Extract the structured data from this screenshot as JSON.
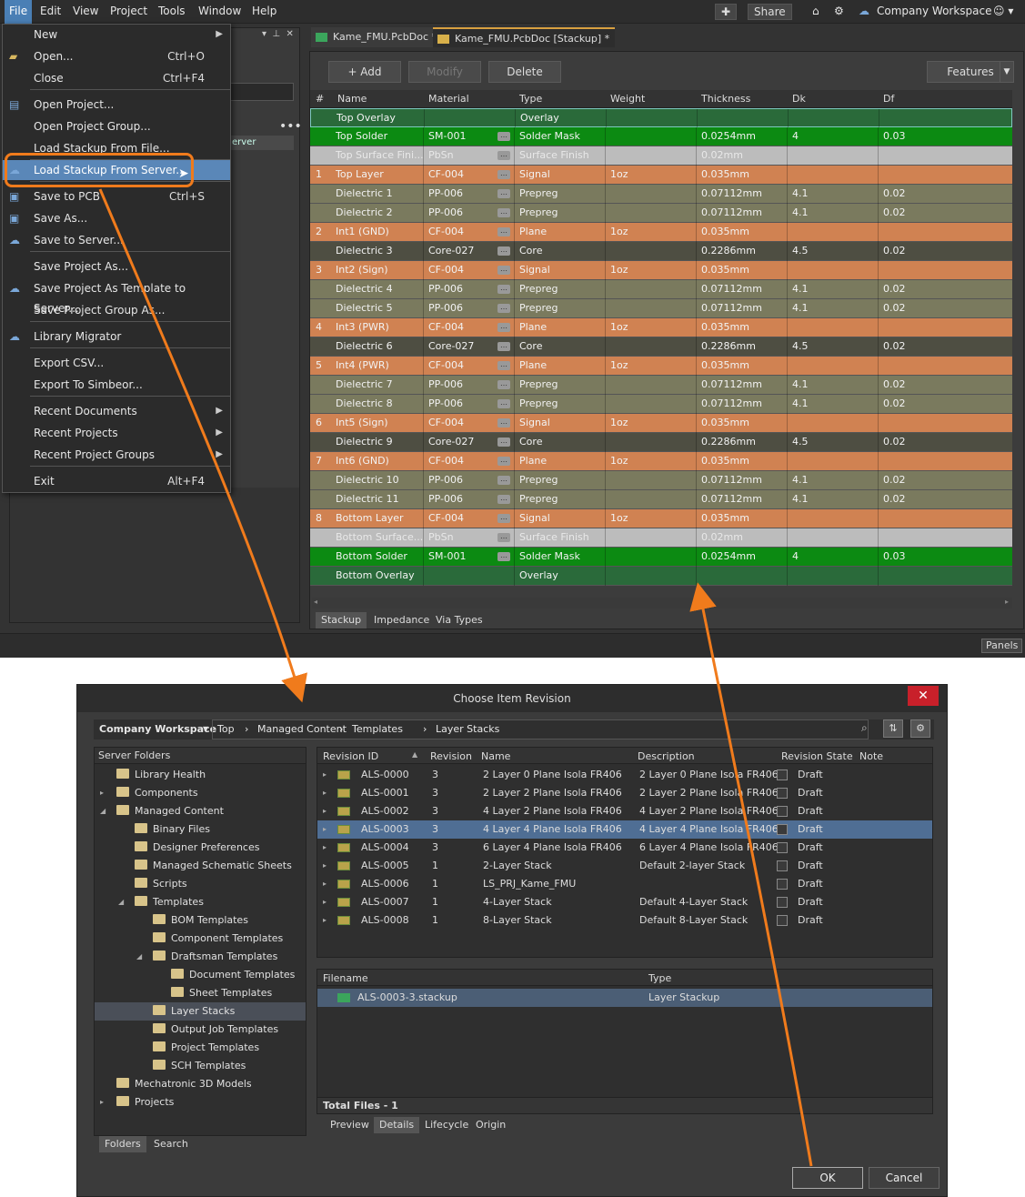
{
  "menubar": {
    "items": [
      "File",
      "Edit",
      "View",
      "Project",
      "Tools",
      "Window",
      "Help"
    ],
    "share": "Share",
    "workspace": "Company Workspace"
  },
  "file_menu": [
    {
      "label": "New",
      "shortcut": "",
      "submenu": true,
      "icon": ""
    },
    {
      "label": "Open...",
      "shortcut": "Ctrl+O",
      "submenu": false,
      "icon": "folder-open-icon"
    },
    {
      "label": "Close",
      "shortcut": "Ctrl+F4",
      "submenu": false,
      "icon": ""
    },
    {
      "label": "Open Project...",
      "shortcut": "",
      "submenu": false,
      "icon": "project-icon"
    },
    {
      "label": "Open Project Group...",
      "shortcut": "",
      "submenu": false,
      "icon": ""
    },
    {
      "label": "Load Stackup From File...",
      "shortcut": "",
      "submenu": false,
      "icon": ""
    },
    {
      "label": "Load Stackup From Server...",
      "shortcut": "",
      "submenu": false,
      "icon": "cloud-icon"
    },
    {
      "label": "Save to PCB",
      "shortcut": "Ctrl+S",
      "submenu": false,
      "icon": "save-icon"
    },
    {
      "label": "Save As...",
      "shortcut": "",
      "submenu": false,
      "icon": "save-as-icon"
    },
    {
      "label": "Save to Server...",
      "shortcut": "",
      "submenu": false,
      "icon": "cloud-save-icon"
    },
    {
      "label": "Save Project As...",
      "shortcut": "",
      "submenu": false,
      "icon": ""
    },
    {
      "label": "Save Project As Template to Server...",
      "shortcut": "",
      "submenu": false,
      "icon": "cloud-template-icon"
    },
    {
      "label": "Save Project Group As...",
      "shortcut": "",
      "submenu": false,
      "icon": ""
    },
    {
      "label": "Library Migrator",
      "shortcut": "",
      "submenu": false,
      "icon": "cloud-icon"
    },
    {
      "label": "Export CSV...",
      "shortcut": "",
      "submenu": false,
      "icon": ""
    },
    {
      "label": "Export To Simbeor...",
      "shortcut": "",
      "submenu": false,
      "icon": ""
    },
    {
      "label": "Recent Documents",
      "shortcut": "",
      "submenu": true,
      "icon": ""
    },
    {
      "label": "Recent Projects",
      "shortcut": "",
      "submenu": true,
      "icon": ""
    },
    {
      "label": "Recent Project Groups",
      "shortcut": "",
      "submenu": true,
      "icon": ""
    },
    {
      "label": "Exit",
      "shortcut": "Alt+F4",
      "submenu": false,
      "icon": ""
    }
  ],
  "left_panel": {
    "partial_text": "erver"
  },
  "doc_tabs": [
    "Kame_FMU.PcbDoc *",
    "Kame_FMU.PcbDoc [Stackup] *"
  ],
  "stackup": {
    "buttons": {
      "add": "+ Add",
      "modify": "Modify",
      "delete": "Delete",
      "features": "Features"
    },
    "columns": [
      "#",
      "Name",
      "Material",
      "Type",
      "Weight",
      "Thickness",
      "Dk",
      "Df"
    ],
    "rows": [
      {
        "num": "",
        "name": "Top Overlay",
        "material": "",
        "type": "Overlay",
        "weight": "",
        "thickness": "",
        "dk": "",
        "df": "",
        "color": "#2a6a3a"
      },
      {
        "num": "",
        "name": "Top Solder",
        "material": "SM-001",
        "type": "Solder Mask",
        "weight": "",
        "thickness": "0.0254mm",
        "dk": "4",
        "df": "0.03",
        "color": "#0c8a12"
      },
      {
        "num": "",
        "name": "Top Surface Fini...",
        "material": "PbSn",
        "type": "Surface Finish",
        "weight": "",
        "thickness": "0.02mm",
        "dk": "",
        "df": "",
        "color": "#bcbcbc"
      },
      {
        "num": "1",
        "name": "Top Layer",
        "material": "CF-004",
        "type": "Signal",
        "weight": "1oz",
        "thickness": "0.035mm",
        "dk": "",
        "df": "",
        "color": "#d08252"
      },
      {
        "num": "",
        "name": "Dielectric 1",
        "material": "PP-006",
        "type": "Prepreg",
        "weight": "",
        "thickness": "0.07112mm",
        "dk": "4.1",
        "df": "0.02",
        "color": "#7a7a5e"
      },
      {
        "num": "",
        "name": "Dielectric 2",
        "material": "PP-006",
        "type": "Prepreg",
        "weight": "",
        "thickness": "0.07112mm",
        "dk": "4.1",
        "df": "0.02",
        "color": "#7a7a5e"
      },
      {
        "num": "2",
        "name": "Int1 (GND)",
        "material": "CF-004",
        "type": "Plane",
        "weight": "1oz",
        "thickness": "0.035mm",
        "dk": "",
        "df": "",
        "color": "#d08252"
      },
      {
        "num": "",
        "name": "Dielectric 3",
        "material": "Core-027",
        "type": "Core",
        "weight": "",
        "thickness": "0.2286mm",
        "dk": "4.5",
        "df": "0.02",
        "color": "#4e4e42"
      },
      {
        "num": "3",
        "name": "Int2 (Sign)",
        "material": "CF-004",
        "type": "Signal",
        "weight": "1oz",
        "thickness": "0.035mm",
        "dk": "",
        "df": "",
        "color": "#d08252"
      },
      {
        "num": "",
        "name": "Dielectric 4",
        "material": "PP-006",
        "type": "Prepreg",
        "weight": "",
        "thickness": "0.07112mm",
        "dk": "4.1",
        "df": "0.02",
        "color": "#7a7a5e"
      },
      {
        "num": "",
        "name": "Dielectric 5",
        "material": "PP-006",
        "type": "Prepreg",
        "weight": "",
        "thickness": "0.07112mm",
        "dk": "4.1",
        "df": "0.02",
        "color": "#7a7a5e"
      },
      {
        "num": "4",
        "name": "Int3 (PWR)",
        "material": "CF-004",
        "type": "Plane",
        "weight": "1oz",
        "thickness": "0.035mm",
        "dk": "",
        "df": "",
        "color": "#d08252"
      },
      {
        "num": "",
        "name": "Dielectric 6",
        "material": "Core-027",
        "type": "Core",
        "weight": "",
        "thickness": "0.2286mm",
        "dk": "4.5",
        "df": "0.02",
        "color": "#4e4e42"
      },
      {
        "num": "5",
        "name": "Int4 (PWR)",
        "material": "CF-004",
        "type": "Plane",
        "weight": "1oz",
        "thickness": "0.035mm",
        "dk": "",
        "df": "",
        "color": "#d08252"
      },
      {
        "num": "",
        "name": "Dielectric 7",
        "material": "PP-006",
        "type": "Prepreg",
        "weight": "",
        "thickness": "0.07112mm",
        "dk": "4.1",
        "df": "0.02",
        "color": "#7a7a5e"
      },
      {
        "num": "",
        "name": "Dielectric 8",
        "material": "PP-006",
        "type": "Prepreg",
        "weight": "",
        "thickness": "0.07112mm",
        "dk": "4.1",
        "df": "0.02",
        "color": "#7a7a5e"
      },
      {
        "num": "6",
        "name": "Int5 (Sign)",
        "material": "CF-004",
        "type": "Signal",
        "weight": "1oz",
        "thickness": "0.035mm",
        "dk": "",
        "df": "",
        "color": "#d08252"
      },
      {
        "num": "",
        "name": "Dielectric 9",
        "material": "Core-027",
        "type": "Core",
        "weight": "",
        "thickness": "0.2286mm",
        "dk": "4.5",
        "df": "0.02",
        "color": "#4e4e42"
      },
      {
        "num": "7",
        "name": "Int6 (GND)",
        "material": "CF-004",
        "type": "Plane",
        "weight": "1oz",
        "thickness": "0.035mm",
        "dk": "",
        "df": "",
        "color": "#d08252"
      },
      {
        "num": "",
        "name": "Dielectric 10",
        "material": "PP-006",
        "type": "Prepreg",
        "weight": "",
        "thickness": "0.07112mm",
        "dk": "4.1",
        "df": "0.02",
        "color": "#7a7a5e"
      },
      {
        "num": "",
        "name": "Dielectric 11",
        "material": "PP-006",
        "type": "Prepreg",
        "weight": "",
        "thickness": "0.07112mm",
        "dk": "4.1",
        "df": "0.02",
        "color": "#7a7a5e"
      },
      {
        "num": "8",
        "name": "Bottom Layer",
        "material": "CF-004",
        "type": "Signal",
        "weight": "1oz",
        "thickness": "0.035mm",
        "dk": "",
        "df": "",
        "color": "#d08252"
      },
      {
        "num": "",
        "name": "Bottom Surface...",
        "material": "PbSn",
        "type": "Surface Finish",
        "weight": "",
        "thickness": "0.02mm",
        "dk": "",
        "df": "",
        "color": "#bcbcbc"
      },
      {
        "num": "",
        "name": "Bottom Solder",
        "material": "SM-001",
        "type": "Solder Mask",
        "weight": "",
        "thickness": "0.0254mm",
        "dk": "4",
        "df": "0.03",
        "color": "#0c8a12"
      },
      {
        "num": "",
        "name": "Bottom Overlay",
        "material": "",
        "type": "Overlay",
        "weight": "",
        "thickness": "",
        "dk": "",
        "df": "",
        "color": "#2a6a3a"
      }
    ],
    "tabs": [
      "Stackup",
      "Impedance",
      "Via Types"
    ]
  },
  "statusbar": {
    "panels": "Panels"
  },
  "dialog": {
    "title": "Choose Item Revision",
    "breadcrumb": [
      "Company Workspace",
      "Top",
      "Managed Content",
      "Templates",
      "Layer Stacks"
    ],
    "tree_header": "Server Folders",
    "tree": [
      {
        "label": "Library Health",
        "level": 0,
        "expander": ""
      },
      {
        "label": "Components",
        "level": 0,
        "expander": "▸"
      },
      {
        "label": "Managed Content",
        "level": 0,
        "expander": "◢"
      },
      {
        "label": "Binary Files",
        "level": 1,
        "expander": ""
      },
      {
        "label": "Designer Preferences",
        "level": 1,
        "expander": ""
      },
      {
        "label": "Managed Schematic Sheets",
        "level": 1,
        "expander": ""
      },
      {
        "label": "Scripts",
        "level": 1,
        "expander": ""
      },
      {
        "label": "Templates",
        "level": 1,
        "expander": "◢"
      },
      {
        "label": "BOM Templates",
        "level": 2,
        "expander": ""
      },
      {
        "label": "Component Templates",
        "level": 2,
        "expander": ""
      },
      {
        "label": "Draftsman Templates",
        "level": 2,
        "expander": "◢"
      },
      {
        "label": "Document Templates",
        "level": 3,
        "expander": ""
      },
      {
        "label": "Sheet Templates",
        "level": 3,
        "expander": ""
      },
      {
        "label": "Layer Stacks",
        "level": 2,
        "expander": "",
        "selected": true
      },
      {
        "label": "Output Job Templates",
        "level": 2,
        "expander": ""
      },
      {
        "label": "Project Templates",
        "level": 2,
        "expander": ""
      },
      {
        "label": "SCH Templates",
        "level": 2,
        "expander": ""
      },
      {
        "label": "Mechatronic 3D Models",
        "level": 0,
        "expander": ""
      },
      {
        "label": "Projects",
        "level": 0,
        "expander": "▸"
      }
    ],
    "tree_tabs": [
      "Folders",
      "Search"
    ],
    "rev_columns": [
      "Revision ID",
      "Revision",
      "Name",
      "Description",
      "Revision State",
      "Note"
    ],
    "revisions": [
      {
        "id": "ALS-0000",
        "rev": "3",
        "name": "2 Layer 0 Plane Isola FR406",
        "desc": "2 Layer 0 Plane Isola FR406",
        "state": "Draft"
      },
      {
        "id": "ALS-0001",
        "rev": "3",
        "name": "2 Layer 2 Plane Isola FR406",
        "desc": "2 Layer 2 Plane Isola FR406",
        "state": "Draft"
      },
      {
        "id": "ALS-0002",
        "rev": "3",
        "name": "4 Layer 2 Plane Isola FR406",
        "desc": "4 Layer 2 Plane Isola FR406",
        "state": "Draft"
      },
      {
        "id": "ALS-0003",
        "rev": "3",
        "name": "4 Layer 4 Plane Isola FR406",
        "desc": "4 Layer 4 Plane Isola FR406",
        "state": "Draft",
        "selected": true
      },
      {
        "id": "ALS-0004",
        "rev": "3",
        "name": "6 Layer 4 Plane Isola FR406",
        "desc": "6 Layer 4 Plane Isola FR406",
        "state": "Draft"
      },
      {
        "id": "ALS-0005",
        "rev": "1",
        "name": "2-Layer Stack",
        "desc": "Default 2-layer Stack",
        "state": "Draft"
      },
      {
        "id": "ALS-0006",
        "rev": "1",
        "name": "LS_PRJ_Kame_FMU",
        "desc": "",
        "state": "Draft"
      },
      {
        "id": "ALS-0007",
        "rev": "1",
        "name": "4-Layer Stack",
        "desc": "Default 4-Layer Stack",
        "state": "Draft"
      },
      {
        "id": "ALS-0008",
        "rev": "1",
        "name": "8-Layer Stack",
        "desc": "Default 8-Layer Stack",
        "state": "Draft"
      }
    ],
    "file_columns": [
      "Filename",
      "Type"
    ],
    "files": [
      {
        "name": "ALS-0003-3.stackup",
        "type": "Layer Stackup"
      }
    ],
    "total_files": "Total Files - 1",
    "detail_tabs": [
      "Preview",
      "Details",
      "Lifecycle",
      "Origin"
    ],
    "ok": "OK",
    "cancel": "Cancel"
  },
  "colors": {
    "accent": "#f07b1c",
    "selection": "#4f6e94"
  }
}
